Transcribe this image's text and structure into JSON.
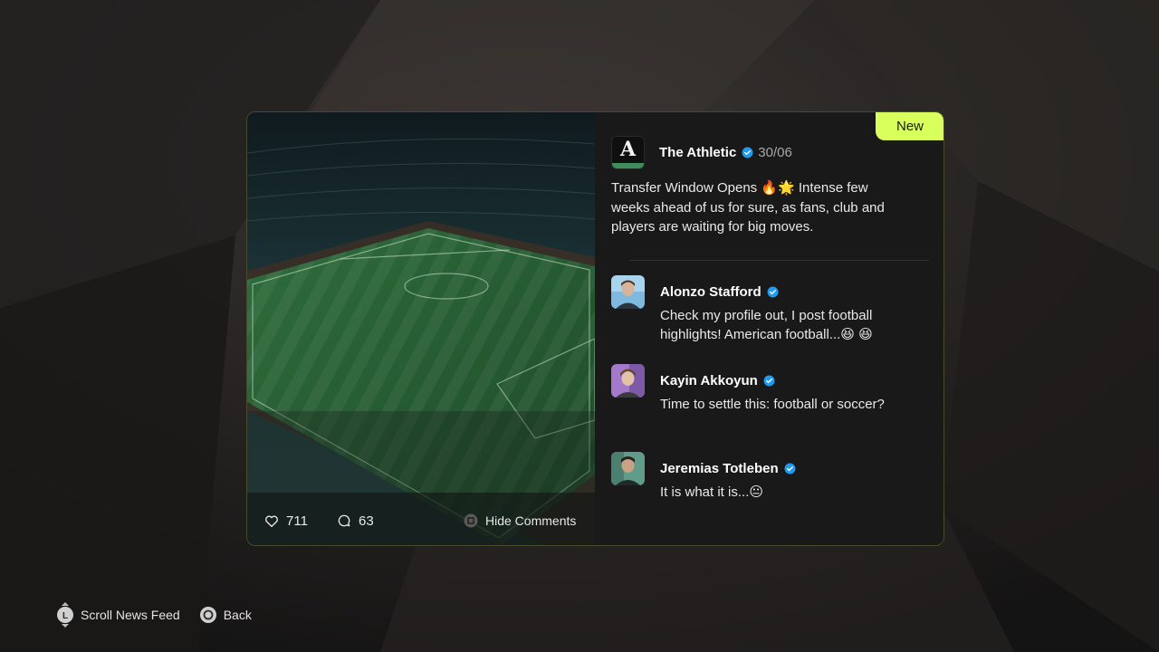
{
  "post": {
    "badge": "New",
    "author": "The Athletic",
    "logo_letter": "A",
    "date": "30/06",
    "text": "Transfer Window Opens 🔥🌟 Intense few weeks ahead of us for sure, as fans, club and players are waiting for big moves.",
    "likes": "711",
    "comments_count": "63",
    "hide_comments_label": "Hide Comments"
  },
  "comments": [
    {
      "name": "Alonzo Stafford",
      "text": "Check my profile out, I post football highlights! American football...😆 😆"
    },
    {
      "name": "Kayin Akkoyun",
      "text": "Time to settle this: football or soccer?"
    },
    {
      "name": "Jeremias Totleben",
      "text": "It is what it is...😐"
    }
  ],
  "hints": {
    "stick_letter": "L",
    "scroll": "Scroll News Feed",
    "back": "Back"
  },
  "colors": {
    "accent": "#d9ff5c",
    "verified": "#1d9bf0",
    "logo_bar": "#3f8d5c"
  },
  "icons": [
    "heart-icon",
    "comment-icon",
    "square-button-icon",
    "verified-icon",
    "left-stick-icon",
    "circle-button-icon"
  ]
}
